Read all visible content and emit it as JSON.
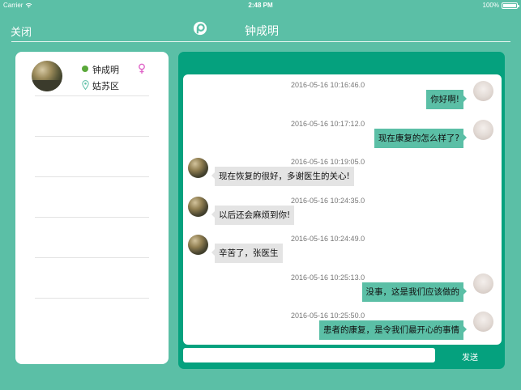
{
  "status_bar": {
    "carrier": "Carrier",
    "time": "2:48 PM",
    "battery": "100%"
  },
  "nav": {
    "close_label": "关闭",
    "title": "钟成明"
  },
  "patient": {
    "name": "钟成明",
    "district": "姑苏区",
    "gender_icon": "female-icon",
    "online_color": "#5aa83a"
  },
  "chat": {
    "messages": [
      {
        "time": "2016-05-16 10:16:46.0",
        "sender": "doctor",
        "text": "你好啊!"
      },
      {
        "time": "2016-05-16 10:17:12.0",
        "sender": "doctor",
        "text": "现在康复的怎么样了?"
      },
      {
        "time": "2016-05-16 10:19:05.0",
        "sender": "patient",
        "text": "现在恢复的很好，多谢医生的关心!"
      },
      {
        "time": "2016-05-16 10:24:35.0",
        "sender": "patient",
        "text": "以后还会麻烦到你!"
      },
      {
        "time": "2016-05-16 10:24:49.0",
        "sender": "patient",
        "text": "辛苦了，张医生"
      },
      {
        "time": "2016-05-16 10:25:13.0",
        "sender": "doctor",
        "text": "没事，这是我们应该做的"
      },
      {
        "time": "2016-05-16 10:25:50.0",
        "sender": "doctor",
        "text": "患者的康复，是令我们最开心的事情"
      }
    ],
    "input_placeholder": "",
    "send_label": "发送"
  },
  "colors": {
    "background": "#5bbfa6",
    "panel_green": "#05a17e",
    "doctor_bubble": "#5bbfa6",
    "patient_bubble": "#e4e4e4"
  }
}
